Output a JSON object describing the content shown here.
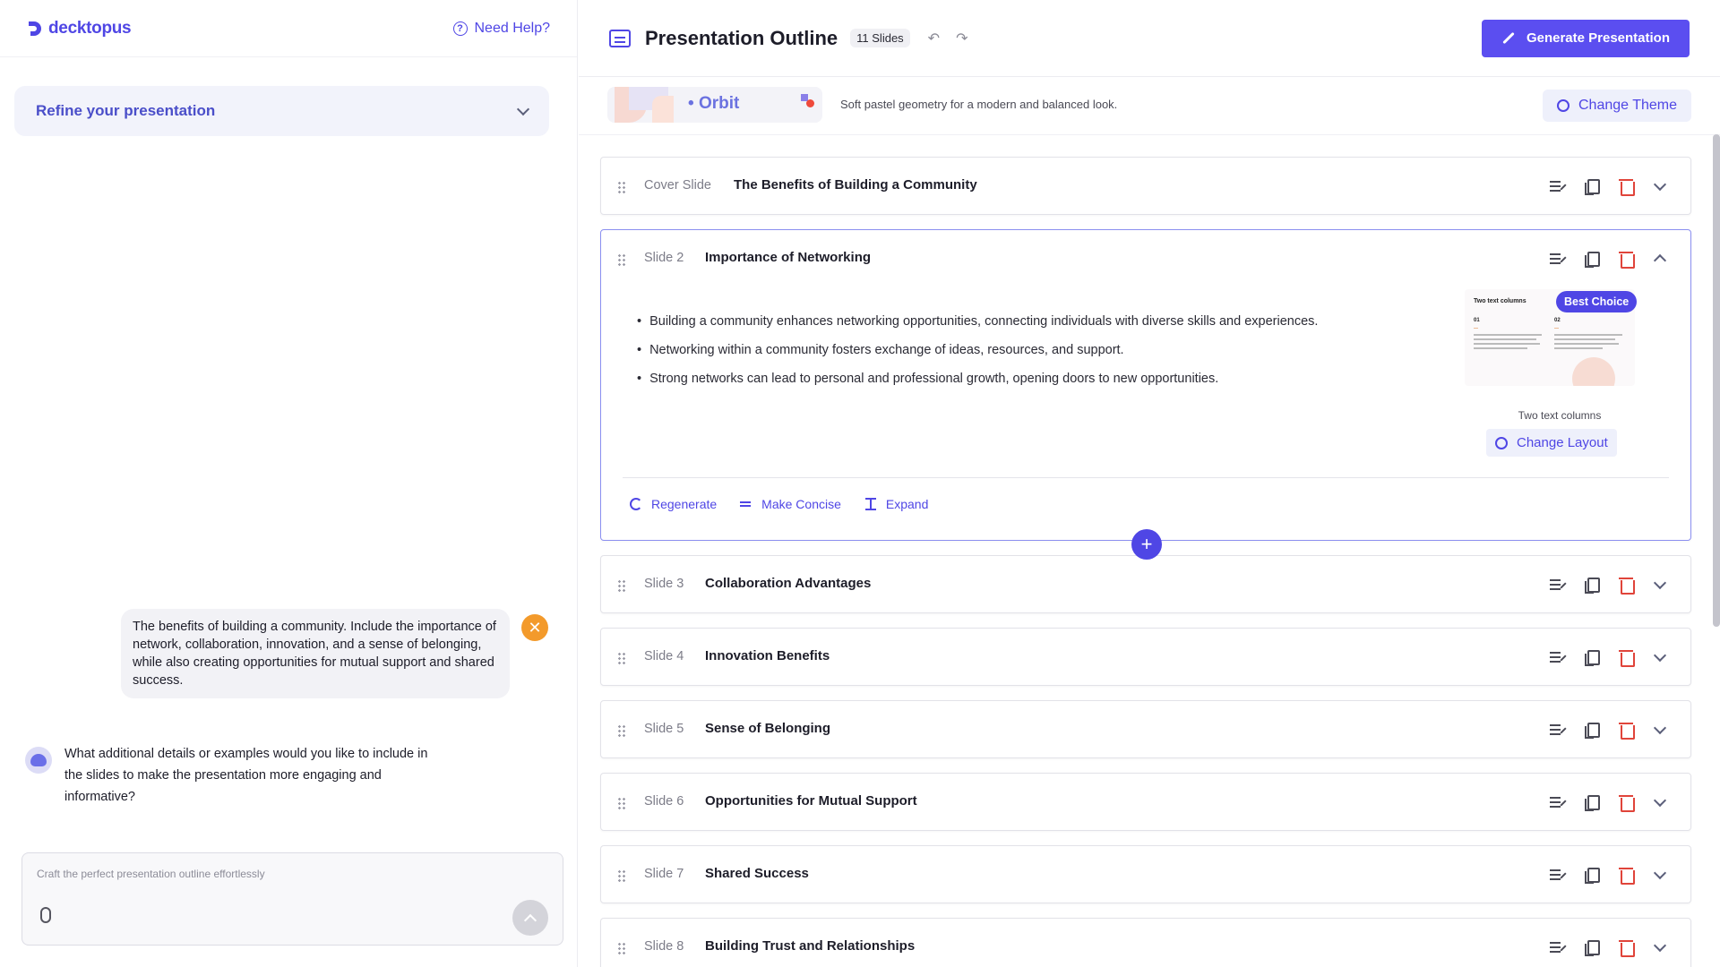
{
  "brand": {
    "name": "decktopus",
    "accent": "#4f46e5"
  },
  "left": {
    "help_label": "Need Help?",
    "refine_title": "Refine your presentation",
    "user_message": "The benefits of building a community. Include the importance of network, collaboration, innovation, and a sense of belonging, while also creating opportunities for mutual support and shared success.",
    "bot_message": "What additional details or examples would you like to include in the slides to make the presentation more engaging and informative?",
    "composer_placeholder": "Craft the perfect presentation outline effortlessly"
  },
  "header": {
    "title": "Presentation Outline",
    "slide_count": "11 Slides",
    "generate_label": "Generate Presentation"
  },
  "theme": {
    "name": "Orbit",
    "description": "Soft pastel geometry for a modern and balanced look.",
    "change_label": "Change Theme"
  },
  "slides": [
    {
      "num": "Cover Slide",
      "title": "The Benefits of Building a Community"
    },
    {
      "num": "Slide 2",
      "title": "Importance of Networking"
    },
    {
      "num": "Slide 3",
      "title": "Collaboration Advantages"
    },
    {
      "num": "Slide 4",
      "title": "Innovation Benefits"
    },
    {
      "num": "Slide 5",
      "title": "Sense of Belonging"
    },
    {
      "num": "Slide 6",
      "title": "Opportunities for Mutual Support"
    },
    {
      "num": "Slide 7",
      "title": "Shared Success"
    },
    {
      "num": "Slide 8",
      "title": "Building Trust and Relationships"
    }
  ],
  "expanded": {
    "bullets": [
      "Building a community enhances networking opportunities, connecting individuals with diverse skills and experiences.",
      "Networking within a community fosters exchange of ideas, resources, and support.",
      "Strong networks can lead to personal and professional growth, opening doors to new opportunities."
    ],
    "best_choice": "Best Choice",
    "layout_name": "Two text columns",
    "change_layout": "Change Layout",
    "thumb_title": "Two text columns",
    "thumb_col1": "01",
    "thumb_col2": "02",
    "tools": {
      "regenerate": "Regenerate",
      "concise": "Make Concise",
      "expand": "Expand"
    }
  }
}
